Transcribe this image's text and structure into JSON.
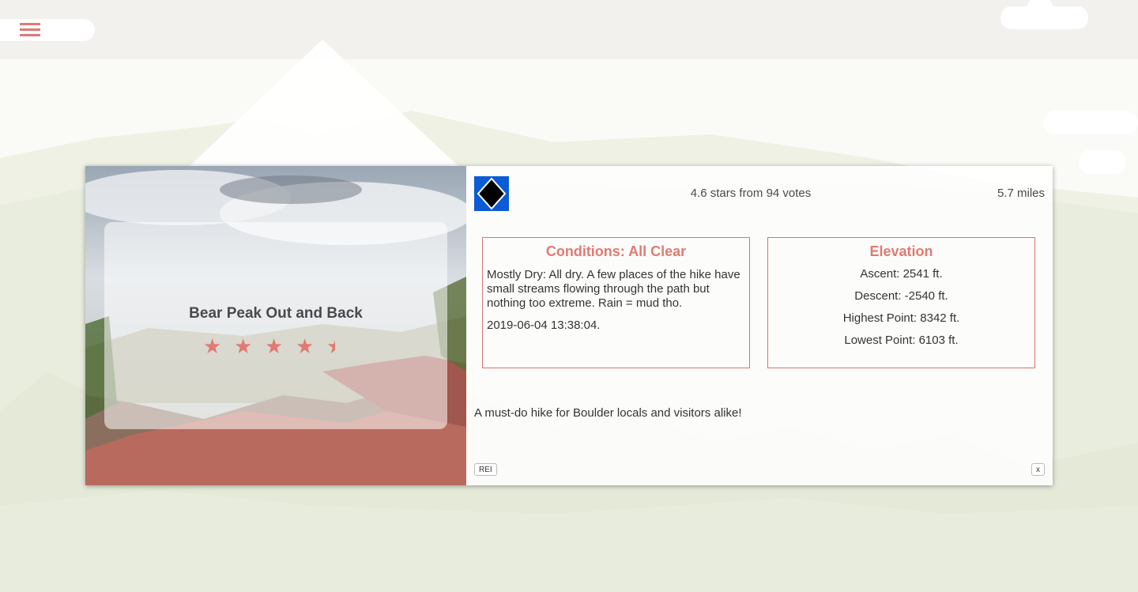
{
  "nav": {
    "menu_icon": "hamburger-icon"
  },
  "trail": {
    "name": "Bear Peak Out and Back",
    "stars": 4.6,
    "rating_text": "4.6 stars from 94 votes",
    "length_text": "5.7 miles",
    "difficulty_icon": "black-diamond-icon",
    "conditions": {
      "heading": "Conditions: All Clear",
      "details": "Mostly Dry: All dry. A few places of the hike have small streams flowing through the path but nothing too extreme. Rain = mud tho.",
      "date": "2019-06-04 13:38:04."
    },
    "elevation": {
      "heading": "Elevation",
      "ascent": "Ascent: 2541 ft.",
      "descent": "Descent: -2540 ft.",
      "high": "Highest Point: 8342 ft.",
      "low": "Lowest Point: 6103 ft."
    },
    "summary": "A must-do hike for Boulder locals and visitors alike!"
  },
  "buttons": {
    "rei": "REI",
    "close": "x"
  },
  "colors": {
    "accent": "#e07a73",
    "difficulty_bg": "#0b5bd6"
  }
}
